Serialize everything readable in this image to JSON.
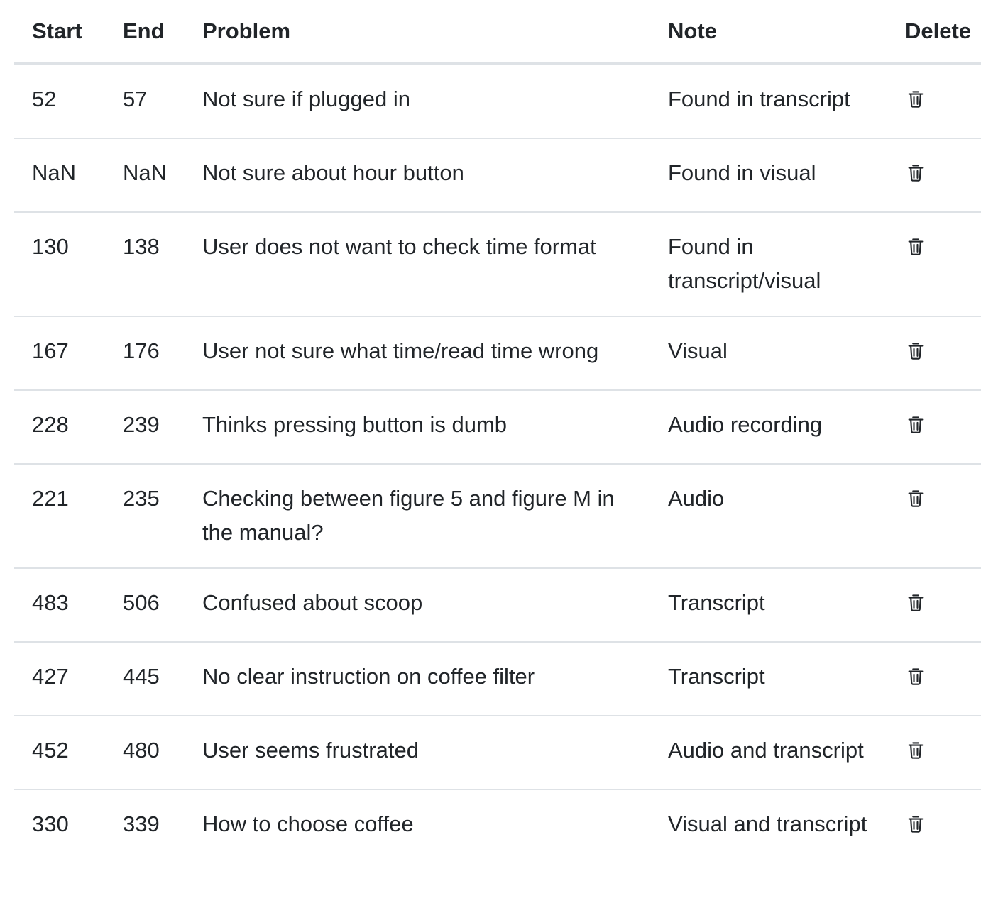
{
  "table": {
    "headers": {
      "start": "Start",
      "end": "End",
      "problem": "Problem",
      "note": "Note",
      "delete": "Delete"
    },
    "rows": [
      {
        "start": "52",
        "end": "57",
        "problem": "Not sure if plugged in",
        "note": "Found in transcript"
      },
      {
        "start": "NaN",
        "end": "NaN",
        "problem": "Not sure about hour button",
        "note": "Found in visual"
      },
      {
        "start": "130",
        "end": "138",
        "problem": "User does not want to check time format",
        "note": "Found in transcript/visual"
      },
      {
        "start": "167",
        "end": "176",
        "problem": "User not sure what time/read time wrong",
        "note": "Visual"
      },
      {
        "start": "228",
        "end": "239",
        "problem": "Thinks pressing button is dumb",
        "note": "Audio recording"
      },
      {
        "start": "221",
        "end": "235",
        "problem": "Checking between figure 5 and figure M in the manual?",
        "note": "Audio"
      },
      {
        "start": "483",
        "end": "506",
        "problem": "Confused about scoop",
        "note": "Transcript"
      },
      {
        "start": "427",
        "end": "445",
        "problem": "No clear instruction on coffee filter",
        "note": "Transcript"
      },
      {
        "start": "452",
        "end": "480",
        "problem": "User seems frustrated",
        "note": "Audio and transcript"
      },
      {
        "start": "330",
        "end": "339",
        "problem": "How to choose coffee",
        "note": "Visual and transcript"
      }
    ],
    "delete_icon": "trash-icon"
  }
}
